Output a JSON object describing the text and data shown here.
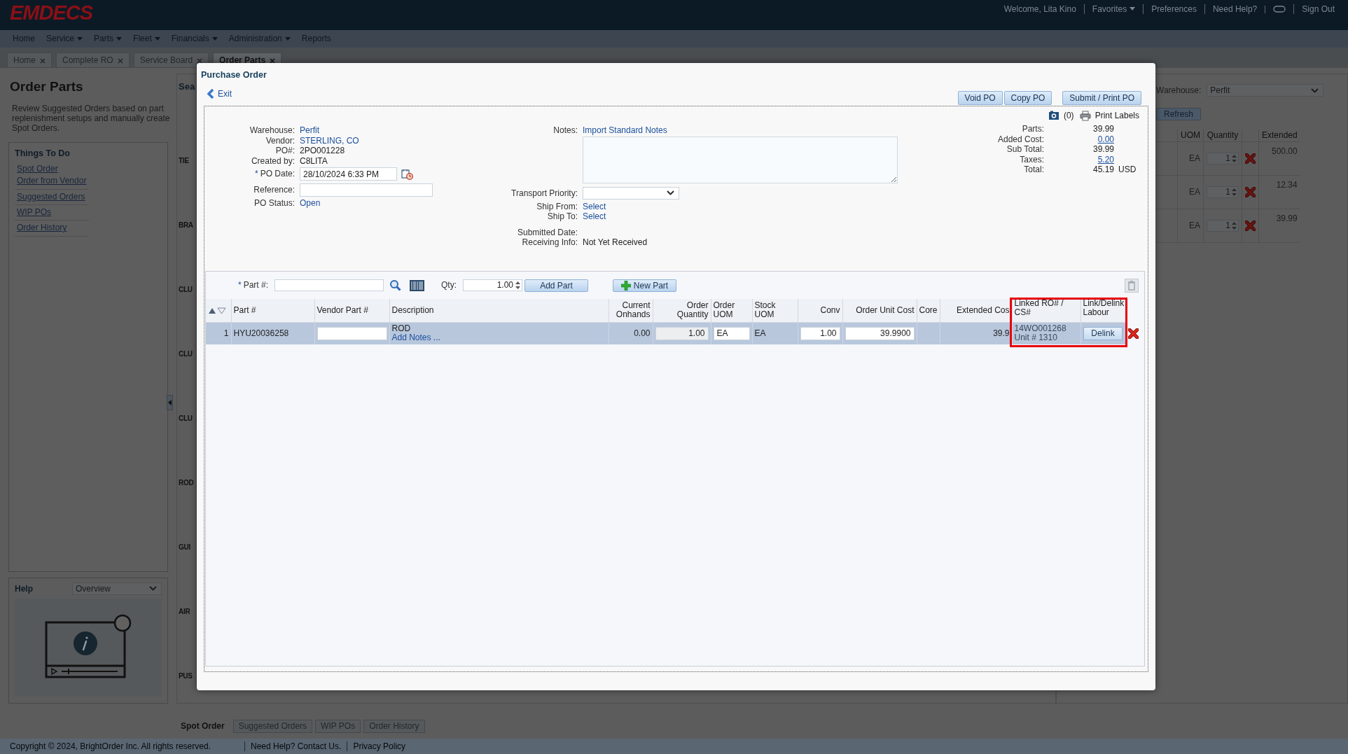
{
  "background_page": {
    "header": {
      "logo": "EMDECS",
      "links": [
        {
          "kind": "text",
          "label": "Welcome, Lita Kino"
        },
        {
          "kind": "dropdown",
          "label": "Favorites"
        },
        {
          "kind": "link",
          "label": "Preferences"
        },
        {
          "kind": "link",
          "label": "Need Help?"
        },
        {
          "kind": "chat"
        },
        {
          "kind": "link",
          "label": "Sign Out"
        }
      ]
    },
    "menu": [
      {
        "label": "Home",
        "dropdown": false
      },
      {
        "label": "Service",
        "dropdown": true
      },
      {
        "label": "Parts",
        "dropdown": true
      },
      {
        "label": "Fleet",
        "dropdown": true
      },
      {
        "label": "Financials",
        "dropdown": true
      },
      {
        "label": "Administration",
        "dropdown": true
      },
      {
        "label": "Reports",
        "dropdown": false
      }
    ],
    "tabs": [
      {
        "label": "Home",
        "selected": false
      },
      {
        "label": "Complete RO",
        "selected": false
      },
      {
        "label": "Service Board",
        "selected": false
      },
      {
        "label": "Order Parts",
        "selected": true
      }
    ],
    "left_panel": {
      "title": "Order Parts",
      "description": "Review Suggested Orders based on part replenishment setups and manually create Spot Orders.",
      "things_to_do": {
        "title": "Things To Do",
        "items": [
          "Spot Order",
          "Order from Vendor",
          "Suggested Orders",
          "WIP POs",
          "Order History"
        ]
      },
      "help": {
        "title": "Help",
        "topic": "Overview"
      }
    },
    "search_panel": {
      "title": "Sea",
      "row_labels": [
        "TIE",
        "BRA",
        "CLU",
        "CLU",
        "CLU",
        "ROD",
        "GUI",
        "AIR",
        "PUS"
      ]
    },
    "bottom_tabs": [
      {
        "label": "Spot Order",
        "selected": true
      },
      {
        "label": "Suggested Orders",
        "selected": false
      },
      {
        "label": "WIP POs",
        "selected": false
      },
      {
        "label": "Order History",
        "selected": false
      }
    ],
    "right_panel": {
      "warehouse_label": "Warehouse:",
      "warehouse": "Perfit",
      "refresh_button": "Refresh",
      "columns": [
        "UOM",
        "Quantity",
        "Extended"
      ],
      "rows": [
        {
          "uom": "EA",
          "quantity": "1",
          "extended": "500.00"
        },
        {
          "uom": "EA",
          "quantity": "1",
          "extended": "12.34"
        },
        {
          "uom": "EA",
          "quantity": "1",
          "extended": "39.99"
        }
      ]
    },
    "footer": {
      "copyright": "Copyright © 2024, BrightOrder Inc. All rights reserved.",
      "links": [
        "Need Help? Contact Us.",
        "Privacy Policy"
      ]
    }
  },
  "purchase_order": {
    "title": "Purchase Order",
    "exit": "Exit",
    "buttons": [
      "Void PO",
      "Copy PO",
      "Submit / Print PO"
    ],
    "left_fields": [
      {
        "kind": "link",
        "label": "Warehouse:",
        "value": "Perfit"
      },
      {
        "kind": "link",
        "label": "Vendor:",
        "value": "STERLING, CO"
      },
      {
        "kind": "text",
        "label": "PO#:",
        "value": "2PO001228"
      },
      {
        "kind": "text",
        "label": "Created by:",
        "value": "C8LITA"
      },
      {
        "kind": "date",
        "required_mark": "*",
        "label": "PO Date:",
        "value": "28/10/2024 6:33 PM"
      },
      {
        "kind": "input",
        "label": "Reference:"
      },
      {
        "kind": "link",
        "label": "PO Status:",
        "value": "Open"
      }
    ],
    "middle_fields": [
      {
        "kind": "link",
        "label": "Notes:",
        "value": "Import Standard Notes"
      },
      {
        "kind": "textarea"
      },
      {
        "kind": "select",
        "label": "Transport Priority:"
      },
      {
        "kind": "link",
        "label": "Ship From:",
        "value": "Select"
      },
      {
        "kind": "link",
        "label": "Ship To:",
        "value": "Select"
      },
      {
        "kind": "text",
        "label": "Submitted Date:"
      },
      {
        "kind": "text",
        "label": "Receiving Info:",
        "value": "Not Yet Received"
      }
    ],
    "attachments": "(0)",
    "print_labels": "Print Labels",
    "totals": [
      {
        "label": "Parts:",
        "value": "39.99",
        "link": false
      },
      {
        "label": "Added Cost:",
        "value": "0.00",
        "link": true
      },
      {
        "label": "Sub Total:",
        "value": "39.99",
        "link": false
      },
      {
        "label": "Taxes:",
        "value": "5.20",
        "link": true
      },
      {
        "label": "Total:",
        "value": "45.19",
        "link": false,
        "currency": "USD"
      }
    ],
    "grid": {
      "toolbar": {
        "part_required_mark": "*",
        "part_label": "Part #:",
        "qty_label": "Qty:",
        "qty_value": "1.00",
        "add_button": "Add Part",
        "new_button": "New Part"
      },
      "columns": [
        {
          "label": "Part #",
          "highlighted": false
        },
        {
          "label": "Vendor Part #",
          "highlighted": false
        },
        {
          "label": "Description",
          "highlighted": false
        },
        {
          "label": "Current Onhands",
          "highlighted": false
        },
        {
          "label": "Order Quantity",
          "highlighted": false
        },
        {
          "label": "Order UOM",
          "highlighted": false
        },
        {
          "label": "Stock UOM",
          "highlighted": false
        },
        {
          "label": "Conv",
          "highlighted": false
        },
        {
          "label": "Order Unit Cost",
          "highlighted": false
        },
        {
          "label": "Core",
          "highlighted": false
        },
        {
          "label": "Extended Cos",
          "highlighted": false
        },
        {
          "label": "Linked RO# / CS#",
          "highlighted": true
        },
        {
          "label": "Link/Delink Labour",
          "highlighted": true
        }
      ],
      "rows": [
        {
          "selected": true,
          "number": "1",
          "part_no": "HYU20036258",
          "description": "ROD",
          "notes_link": "Add Notes ...",
          "current_onhands": "0.00",
          "order_quantity": "1.00",
          "quantity_disabled": true,
          "order_uom": "EA",
          "stock_uom": "EA",
          "conv": "1.00",
          "order_unit_cost": "39.9900",
          "extended_cost": "39.9",
          "linked_ro": "14WO001268",
          "unit": "Unit # 1310",
          "link_button": "Delink"
        }
      ]
    }
  }
}
